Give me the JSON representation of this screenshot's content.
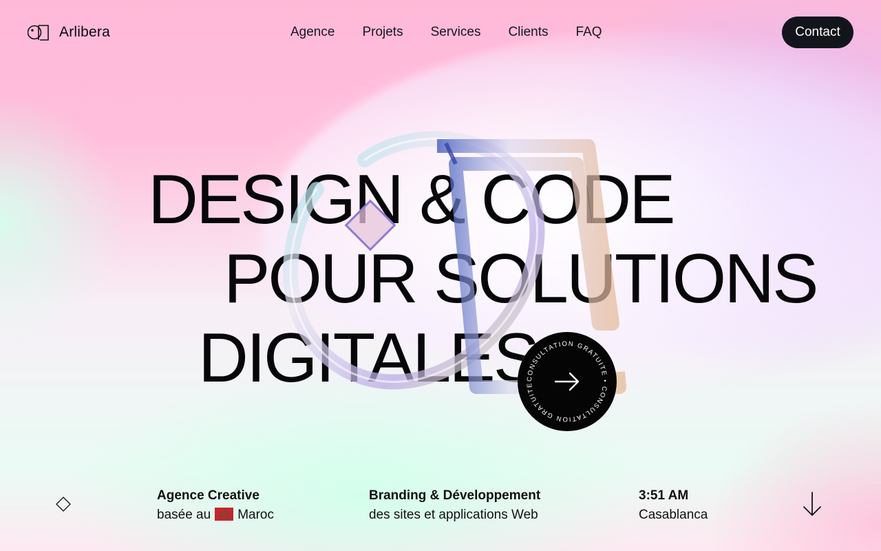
{
  "brand": {
    "name": "Arlibera",
    "logo_icon": "arlibera-logo-icon"
  },
  "nav": {
    "items": [
      {
        "label": "Agence"
      },
      {
        "label": "Projets"
      },
      {
        "label": "Services"
      },
      {
        "label": "Clients"
      },
      {
        "label": "FAQ"
      }
    ]
  },
  "header": {
    "contact_label": "Contact"
  },
  "hero": {
    "line1": "DESIGN & CODE",
    "line2": "POUR SOLUTIONS",
    "line3": "DIGITALES",
    "cta_ring_text": "CONSULTATION GRATUITE • CONSULTATION GRATUITE •",
    "cta_icon": "arrow-right-icon"
  },
  "info": {
    "left": {
      "title": "Agence Creative",
      "line_prefix": "basée au",
      "country": "Maroc",
      "flag_icon": "morocco-flag-icon"
    },
    "middle": {
      "title": "Branding & Développement",
      "line": "des sites et applications Web"
    },
    "right": {
      "time": "3:51 AM",
      "city": "Casablanca"
    }
  },
  "colors": {
    "dark": "#13151c",
    "background_pink": "#ffb9d8",
    "background_lilac": "#d6baff",
    "background_mint": "#d2ffec"
  }
}
